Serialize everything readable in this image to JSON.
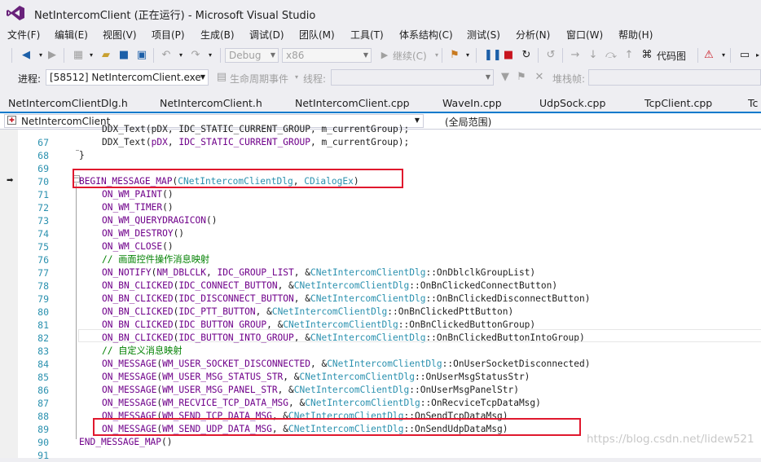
{
  "window": {
    "title": "NetIntercomClient (正在运行) - Microsoft Visual Studio"
  },
  "menu": [
    "文件(F)",
    "编辑(E)",
    "视图(V)",
    "项目(P)",
    "生成(B)",
    "调试(D)",
    "团队(M)",
    "工具(T)",
    "体系结构(C)",
    "测试(S)",
    "分析(N)",
    "窗口(W)",
    "帮助(H)"
  ],
  "toolbar": {
    "config": "Debug",
    "platform": "x86",
    "continue_label": "继续(C)",
    "code_map_label": "代码图"
  },
  "process_bar": {
    "process_label": "进程:",
    "process_value": "[58512] NetIntercomClient.exe",
    "lifecycle_label": "生命周期事件",
    "thread_label": "线程:",
    "stack_label": "堆栈帧:"
  },
  "tabs": [
    "NetIntercomClientDlg.h",
    "NetIntercomClient.h",
    "NetIntercomClient.cpp",
    "WaveIn.cpp",
    "UdpSock.cpp",
    "TcpClient.cpp",
    "Tc"
  ],
  "navbar": {
    "project": "NetIntercomClient",
    "scope": "(全局范围)"
  },
  "code": {
    "lines": [
      {
        "n": "",
        "indent": "\t",
        "t": [
          {
            "c": "",
            "v": "DDX_Text(pDX, IDC_STATIC_CURRENT_GROUP, m_currentGroup);"
          }
        ]
      },
      {
        "n": "67",
        "indent": "\t",
        "t": [
          {
            "c": "",
            "v": "DDX_Text("
          },
          {
            "c": "kw",
            "v": "pDX"
          },
          {
            "c": "",
            "v": ", "
          },
          {
            "c": "kw",
            "v": "IDC_STATIC_CURRENT_GROUP"
          },
          {
            "c": "",
            "v": ", m_currentGroup);"
          }
        ]
      },
      {
        "n": "68",
        "indent": "",
        "t": [
          {
            "c": "",
            "v": "}"
          }
        ]
      },
      {
        "n": "69",
        "indent": "",
        "t": [
          {
            "c": "",
            "v": ""
          }
        ]
      },
      {
        "n": "70",
        "indent": "",
        "t": [
          {
            "c": "kw",
            "v": "BEGIN_MESSAGE_MAP"
          },
          {
            "c": "",
            "v": "("
          },
          {
            "c": "ty",
            "v": "CNetIntercomClientDlg"
          },
          {
            "c": "",
            "v": ", "
          },
          {
            "c": "ty",
            "v": "CDialogEx"
          },
          {
            "c": "",
            "v": ")"
          }
        ]
      },
      {
        "n": "71",
        "indent": "\t",
        "t": [
          {
            "c": "kw",
            "v": "ON_WM_PAINT"
          },
          {
            "c": "",
            "v": "()"
          }
        ]
      },
      {
        "n": "72",
        "indent": "\t",
        "t": [
          {
            "c": "kw",
            "v": "ON_WM_TIMER"
          },
          {
            "c": "",
            "v": "()"
          }
        ]
      },
      {
        "n": "73",
        "indent": "\t",
        "t": [
          {
            "c": "kw",
            "v": "ON_WM_QUERYDRAGICON"
          },
          {
            "c": "",
            "v": "()"
          }
        ]
      },
      {
        "n": "74",
        "indent": "\t",
        "t": [
          {
            "c": "kw",
            "v": "ON_WM_DESTROY"
          },
          {
            "c": "",
            "v": "()"
          }
        ]
      },
      {
        "n": "75",
        "indent": "\t",
        "t": [
          {
            "c": "kw",
            "v": "ON_WM_CLOSE"
          },
          {
            "c": "",
            "v": "()"
          }
        ]
      },
      {
        "n": "76",
        "indent": "\t",
        "t": [
          {
            "c": "cm",
            "v": "// 画面控件操作消息映射"
          }
        ]
      },
      {
        "n": "77",
        "indent": "\t",
        "t": [
          {
            "c": "kw",
            "v": "ON_NOTIFY"
          },
          {
            "c": "",
            "v": "("
          },
          {
            "c": "kw",
            "v": "NM_DBLCLK"
          },
          {
            "c": "",
            "v": ", "
          },
          {
            "c": "kw",
            "v": "IDC_GROUP_LIST"
          },
          {
            "c": "",
            "v": ", &"
          },
          {
            "c": "ty",
            "v": "CNetIntercomClientDlg"
          },
          {
            "c": "",
            "v": "::OnDblclkGroupList)"
          }
        ]
      },
      {
        "n": "78",
        "indent": "\t",
        "t": [
          {
            "c": "kw",
            "v": "ON_BN_CLICKED"
          },
          {
            "c": "",
            "v": "("
          },
          {
            "c": "kw",
            "v": "IDC_CONNECT_BUTTON"
          },
          {
            "c": "",
            "v": ", &"
          },
          {
            "c": "ty",
            "v": "CNetIntercomClientDlg"
          },
          {
            "c": "",
            "v": "::OnBnClickedConnectButton)"
          }
        ]
      },
      {
        "n": "79",
        "indent": "\t",
        "t": [
          {
            "c": "kw",
            "v": "ON_BN_CLICKED"
          },
          {
            "c": "",
            "v": "("
          },
          {
            "c": "kw",
            "v": "IDC_DISCONNECT_BUTTON"
          },
          {
            "c": "",
            "v": ", &"
          },
          {
            "c": "ty",
            "v": "CNetIntercomClientDlg"
          },
          {
            "c": "",
            "v": "::OnBnClickedDisconnectButton)"
          }
        ]
      },
      {
        "n": "80",
        "indent": "\t",
        "t": [
          {
            "c": "kw",
            "v": "ON_BN_CLICKED"
          },
          {
            "c": "",
            "v": "("
          },
          {
            "c": "kw",
            "v": "IDC_PTT_BUTTON"
          },
          {
            "c": "",
            "v": ", &"
          },
          {
            "c": "ty",
            "v": "CNetIntercomClientDlg"
          },
          {
            "c": "",
            "v": "::OnBnClickedPttButton)"
          }
        ]
      },
      {
        "n": "81",
        "indent": "\t",
        "t": [
          {
            "c": "kw",
            "v": "ON_BN_CLICKED"
          },
          {
            "c": "",
            "v": "("
          },
          {
            "c": "kw",
            "v": "IDC_BUTTON_GROUP"
          },
          {
            "c": "",
            "v": ", &"
          },
          {
            "c": "ty",
            "v": "CNetIntercomClientDlg"
          },
          {
            "c": "",
            "v": "::OnBnClickedButtonGroup)"
          }
        ]
      },
      {
        "n": "82",
        "indent": "\t",
        "t": [
          {
            "c": "kw",
            "v": "ON_BN_CLICKED"
          },
          {
            "c": "",
            "v": "("
          },
          {
            "c": "kw",
            "v": "IDC_BUTTON_INTO_GROUP"
          },
          {
            "c": "",
            "v": ", &"
          },
          {
            "c": "ty",
            "v": "CNetIntercomClientDlg"
          },
          {
            "c": "",
            "v": "::OnBnClickedButtonIntoGroup)"
          }
        ]
      },
      {
        "n": "83",
        "indent": "\t",
        "t": [
          {
            "c": "cm",
            "v": "// 自定义消息映射"
          }
        ]
      },
      {
        "n": "84",
        "indent": "\t",
        "t": [
          {
            "c": "kw",
            "v": "ON_MESSAGE"
          },
          {
            "c": "",
            "v": "("
          },
          {
            "c": "kw",
            "v": "WM_USER_SOCKET_DISCONNECTED"
          },
          {
            "c": "",
            "v": ", &"
          },
          {
            "c": "ty",
            "v": "CNetIntercomClientDlg"
          },
          {
            "c": "",
            "v": "::OnUserSocketDisconnected)"
          }
        ]
      },
      {
        "n": "85",
        "indent": "\t",
        "t": [
          {
            "c": "kw",
            "v": "ON_MESSAGE"
          },
          {
            "c": "",
            "v": "("
          },
          {
            "c": "kw",
            "v": "WM_USER_MSG_STATUS_STR"
          },
          {
            "c": "",
            "v": ", &"
          },
          {
            "c": "ty",
            "v": "CNetIntercomClientDlg"
          },
          {
            "c": "",
            "v": "::OnUserMsgStatusStr)"
          }
        ]
      },
      {
        "n": "86",
        "indent": "\t",
        "t": [
          {
            "c": "kw",
            "v": "ON_MESSAGE"
          },
          {
            "c": "",
            "v": "("
          },
          {
            "c": "kw",
            "v": "WM_USER_MSG_PANEL_STR"
          },
          {
            "c": "",
            "v": ", &"
          },
          {
            "c": "ty",
            "v": "CNetIntercomClientDlg"
          },
          {
            "c": "",
            "v": "::OnUserMsgPanelStr)"
          }
        ]
      },
      {
        "n": "87",
        "indent": "\t",
        "t": [
          {
            "c": "kw",
            "v": "ON_MESSAGE"
          },
          {
            "c": "",
            "v": "("
          },
          {
            "c": "kw",
            "v": "WM_RECVICE_TCP_DATA_MSG"
          },
          {
            "c": "",
            "v": ", &"
          },
          {
            "c": "ty",
            "v": "CNetIntercomClientDlg"
          },
          {
            "c": "",
            "v": "::OnRecviceTcpDataMsg)"
          }
        ]
      },
      {
        "n": "88",
        "indent": "\t",
        "t": [
          {
            "c": "kw",
            "v": "ON_MESSAGE"
          },
          {
            "c": "",
            "v": "("
          },
          {
            "c": "kw",
            "v": "WM_SEND_TCP_DATA_MSG"
          },
          {
            "c": "",
            "v": ", &"
          },
          {
            "c": "ty",
            "v": "CNetIntercomClientDlg"
          },
          {
            "c": "",
            "v": "::OnSendTcpDataMsg)"
          }
        ]
      },
      {
        "n": "89",
        "indent": "\t",
        "t": [
          {
            "c": "kw",
            "v": "ON_MESSAGE"
          },
          {
            "c": "",
            "v": "("
          },
          {
            "c": "kw",
            "v": "WM_SEND_UDP_DATA_MSG"
          },
          {
            "c": "",
            "v": ", &"
          },
          {
            "c": "ty",
            "v": "CNetIntercomClientDlg"
          },
          {
            "c": "",
            "v": "::OnSendUdpDataMsg)"
          }
        ]
      },
      {
        "n": "90",
        "indent": "",
        "t": [
          {
            "c": "kw",
            "v": "END_MESSAGE_MAP"
          },
          {
            "c": "",
            "v": "()"
          }
        ]
      },
      {
        "n": "91",
        "indent": "",
        "t": [
          {
            "c": "",
            "v": ""
          }
        ]
      }
    ]
  },
  "watermark": "https://blog.csdn.net/lidew521",
  "colors": {
    "accent": "#007acc",
    "highlight_box": "#e0182e",
    "macro": "#6f008a",
    "type": "#2b91af",
    "comment": "#008000"
  }
}
